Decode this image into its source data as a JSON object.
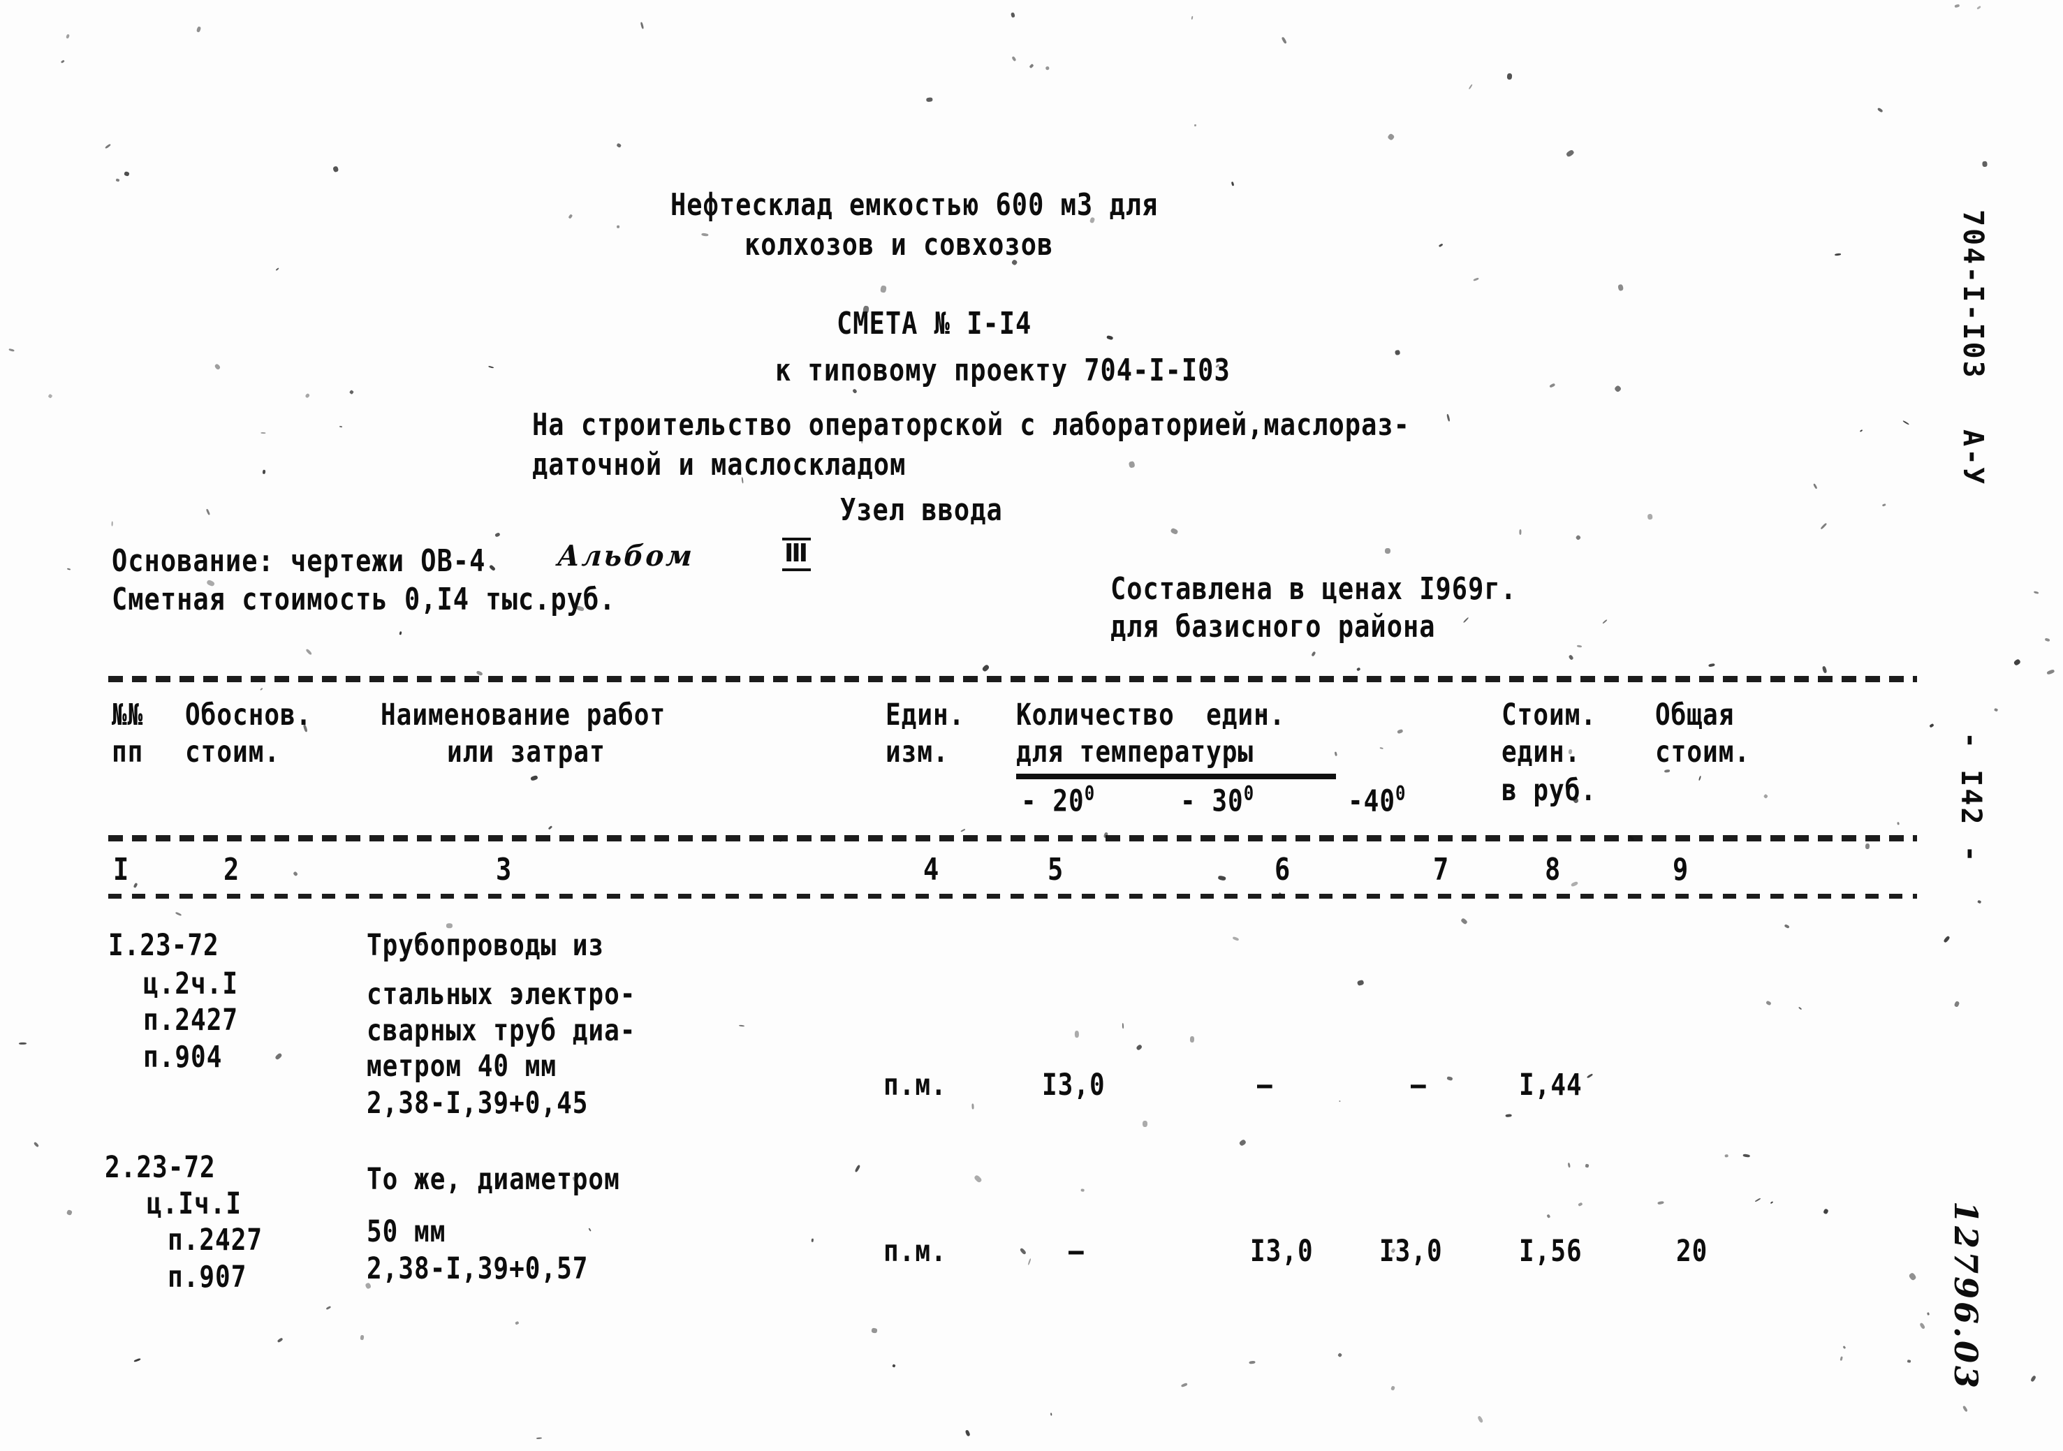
{
  "document": {
    "title_line1": "Нефтесклад емкостью 600 м3 для",
    "title_line2": "колхозов и совхозов",
    "estimate_no": "СМЕТА № I-I4",
    "project_ref": "к типовому проекту 704-I-I03",
    "purpose_line1": "На строительство операторской с лабораторией,маслораз-",
    "purpose_line2": "даточной и маслоскладом",
    "section": "Узел ввода",
    "basis_label": "Основание: чертежи ОВ-4",
    "basis_album_hand": "Альбом",
    "basis_album_roman": "Ⅲ",
    "cost_summary": "Сметная стоимость 0,I4 тыс.руб.",
    "prices_line1": "Составлена в ценах I969г.",
    "prices_line2": "для базисного района"
  },
  "table": {
    "headers": {
      "no_line1": "№№",
      "no_line2": "пп",
      "basis_line1": "Обоснов.",
      "basis_line2": "стоим.",
      "name_line1": "Наименование работ",
      "name_line2": "или затрат",
      "unit_line1": "Един.",
      "unit_line2": "изм.",
      "qty_line1": "Количество  един.",
      "qty_line2": "для температуры",
      "temp_20": "- 20",
      "temp_30": "- 30",
      "temp_40": "-40",
      "temp_deg": "0",
      "unitcost_line1": "Стоим.",
      "unitcost_line2": "един.",
      "unitcost_line3": "в руб.",
      "total_line1": "Общая",
      "total_line2": "стоим."
    },
    "column_numbers": [
      "I",
      "2",
      "3",
      "4",
      "5",
      "6",
      "7",
      "8",
      "9"
    ],
    "rows": [
      {
        "basis": [
          "I.23-72",
          "ц.2ч.I",
          "п.2427",
          "п.904"
        ],
        "name": [
          "Трубопроводы из",
          "стальных электро-",
          "сварных труб диа-",
          "метром 40 мм",
          "2,38-I,39+0,45"
        ],
        "unit": "п.м.",
        "qty_20": "I3,0",
        "qty_30": "–",
        "qty_40": "–",
        "unit_cost": "I,44",
        "total_cost": ""
      },
      {
        "basis": [
          "2.23-72",
          "ц.Iч.I",
          "п.2427",
          "п.907"
        ],
        "name": [
          "То же, диаметром",
          "50 мм",
          "2,38-I,39+0,57"
        ],
        "unit": "п.м.",
        "qty_20": "–",
        "qty_30": "I3,0",
        "qty_40": "I3,0",
        "unit_cost": "I,56",
        "total_cost": "20"
      }
    ]
  },
  "margins": {
    "project_code": "704-I-I03",
    "sheet_code": "А-У",
    "page_number": "- I42 -",
    "archive_number": "12796.03"
  }
}
